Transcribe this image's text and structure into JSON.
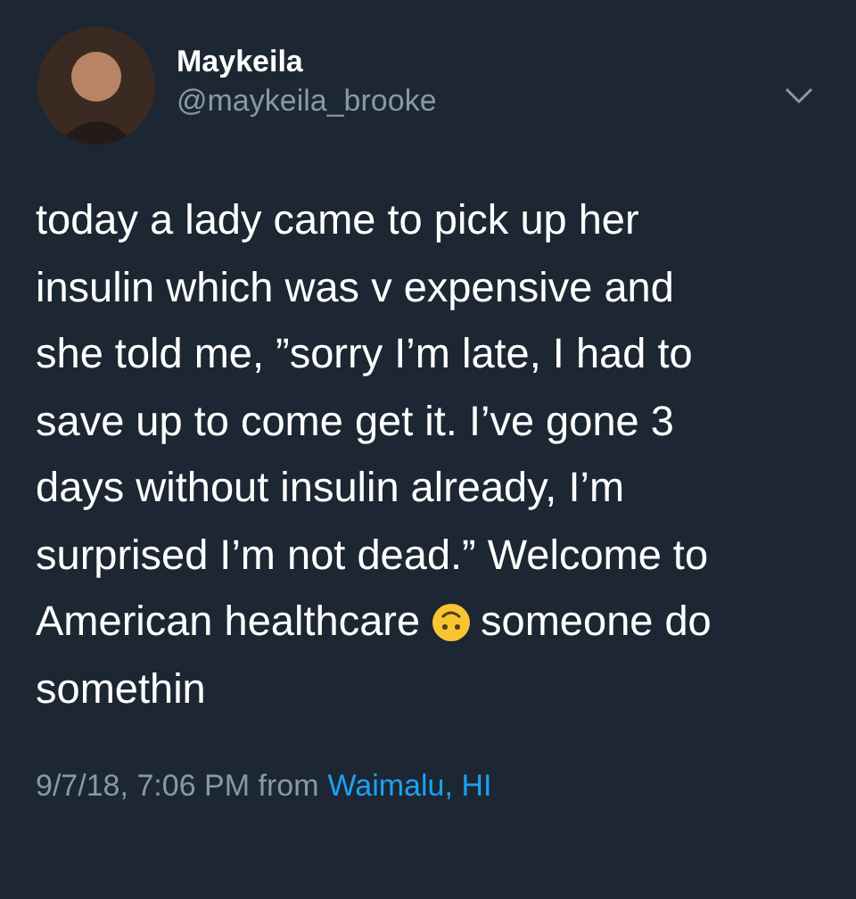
{
  "author": {
    "name": "Maykeila",
    "handle": "@maykeila_brooke"
  },
  "tweet": {
    "lines": [
      [
        {
          "kind": "text",
          "text": "today a lady came to pick up her"
        }
      ],
      [
        {
          "kind": "text",
          "text": "insulin which was v expensive and"
        }
      ],
      [
        {
          "kind": "text",
          "text": "she told me, ”sorry I’m late, I had to"
        }
      ],
      [
        {
          "kind": "text",
          "text": "save up to come get it. I’ve gone 3"
        }
      ],
      [
        {
          "kind": "text",
          "text": "days without insulin already, I’m"
        }
      ],
      [
        {
          "kind": "text",
          "text": "surprised I’m not dead.” Welcome to"
        }
      ],
      [
        {
          "kind": "text",
          "text": "American healthcare"
        },
        {
          "kind": "emoji"
        },
        {
          "kind": "text",
          "text": "someone do"
        }
      ],
      [
        {
          "kind": "text",
          "text": "somethin"
        }
      ]
    ]
  },
  "meta": {
    "timestamp": "9/7/18, 7:06 PM from",
    "location": "Waimalu, HI"
  }
}
